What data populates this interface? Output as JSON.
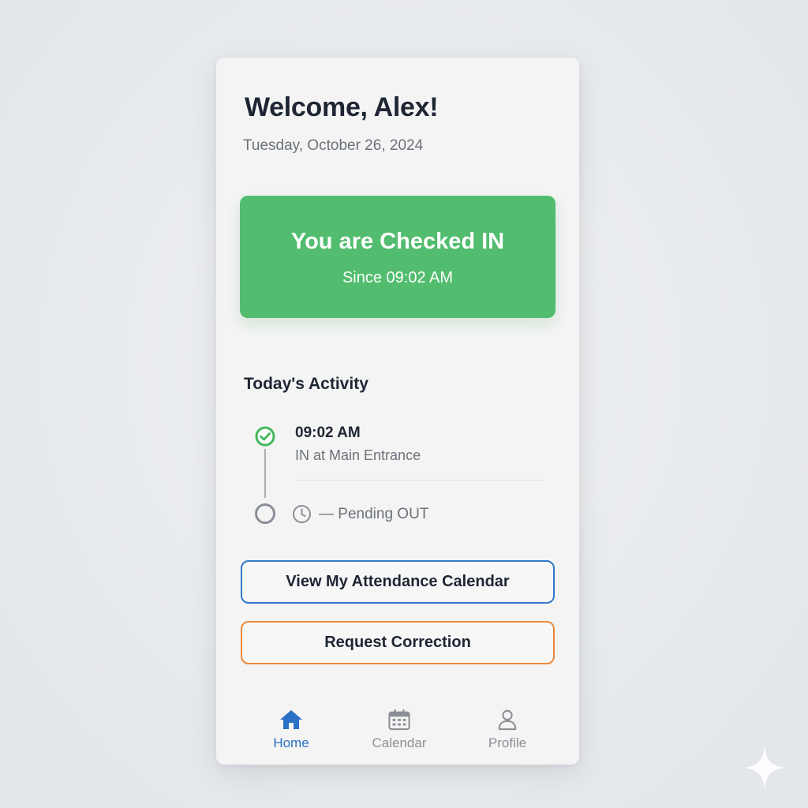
{
  "header": {
    "welcome": "Welcome, Alex!",
    "date": "Tuesday, October 26, 2024"
  },
  "status": {
    "title": "You are Checked IN",
    "since": "Since 09:02 AM",
    "color": "#52bd6e"
  },
  "activity": {
    "title": "Today's Activity",
    "items": [
      {
        "time": "09:02 AM",
        "description": "IN at Main Entrance",
        "icon": "check-circle-icon",
        "state": "done"
      },
      {
        "text": "— Pending OUT",
        "icon": "clock-icon",
        "state": "pending"
      }
    ]
  },
  "actions": {
    "calendar_label": "View My Attendance Calendar",
    "correction_label": "Request Correction"
  },
  "nav": {
    "items": [
      {
        "label": "Home",
        "icon": "home-icon",
        "active": true
      },
      {
        "label": "Calendar",
        "icon": "calendar-icon",
        "active": false
      },
      {
        "label": "Profile",
        "icon": "profile-icon",
        "active": false
      }
    ]
  },
  "colors": {
    "accent_blue": "#2a70c4",
    "accent_orange": "#ec8a3c",
    "success_green": "#52bd6e"
  }
}
